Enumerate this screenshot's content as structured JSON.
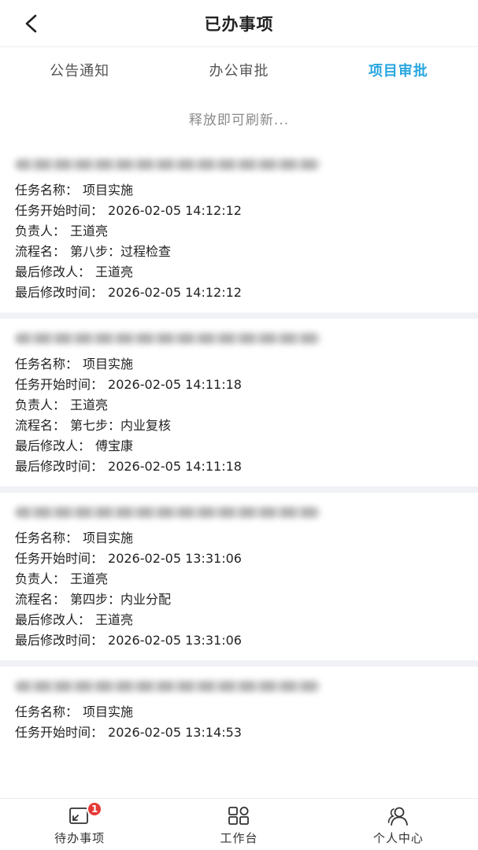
{
  "header": {
    "title": "已办事项"
  },
  "tabs": [
    {
      "label": "公告通知",
      "active": false
    },
    {
      "label": "办公审批",
      "active": false
    },
    {
      "label": "项目审批",
      "active": true
    }
  ],
  "refresh_hint": "释放即可刷新...",
  "labels": {
    "task_name": "任务名称：",
    "task_start": "任务开始时间：",
    "owner": "负责人：",
    "flow": "流程名：",
    "last_editor": "最后修改人：",
    "last_edit_time": "最后修改时间："
  },
  "cards": [
    {
      "task_name": "项目实施",
      "task_start": "2026-02-05 14:12:12",
      "owner": "王道亮",
      "flow": "第八步：过程检查",
      "last_editor": "王道亮",
      "last_edit_time": "2026-02-05 14:12:12"
    },
    {
      "task_name": "项目实施",
      "task_start": "2026-02-05 14:11:18",
      "owner": "王道亮",
      "flow": "第七步：内业复核",
      "last_editor": "傅宝康",
      "last_edit_time": "2026-02-05 14:11:18"
    },
    {
      "task_name": "项目实施",
      "task_start": "2026-02-05 13:31:06",
      "owner": "王道亮",
      "flow": "第四步：内业分配",
      "last_editor": "王道亮",
      "last_edit_time": "2026-02-05 13:31:06"
    },
    {
      "task_name": "项目实施",
      "task_start": "2026-02-05 13:14:53"
    }
  ],
  "nav": {
    "todo": {
      "label": "待办事项",
      "badge": "1",
      "icon": "todo-icon"
    },
    "workbench": {
      "label": "工作台",
      "icon": "grid-icon"
    },
    "profile": {
      "label": "个人中心",
      "icon": "user-group-icon"
    }
  },
  "colors": {
    "accent": "#2aa7e0",
    "badge": "#e53935",
    "separator": "#f1f2f6"
  }
}
